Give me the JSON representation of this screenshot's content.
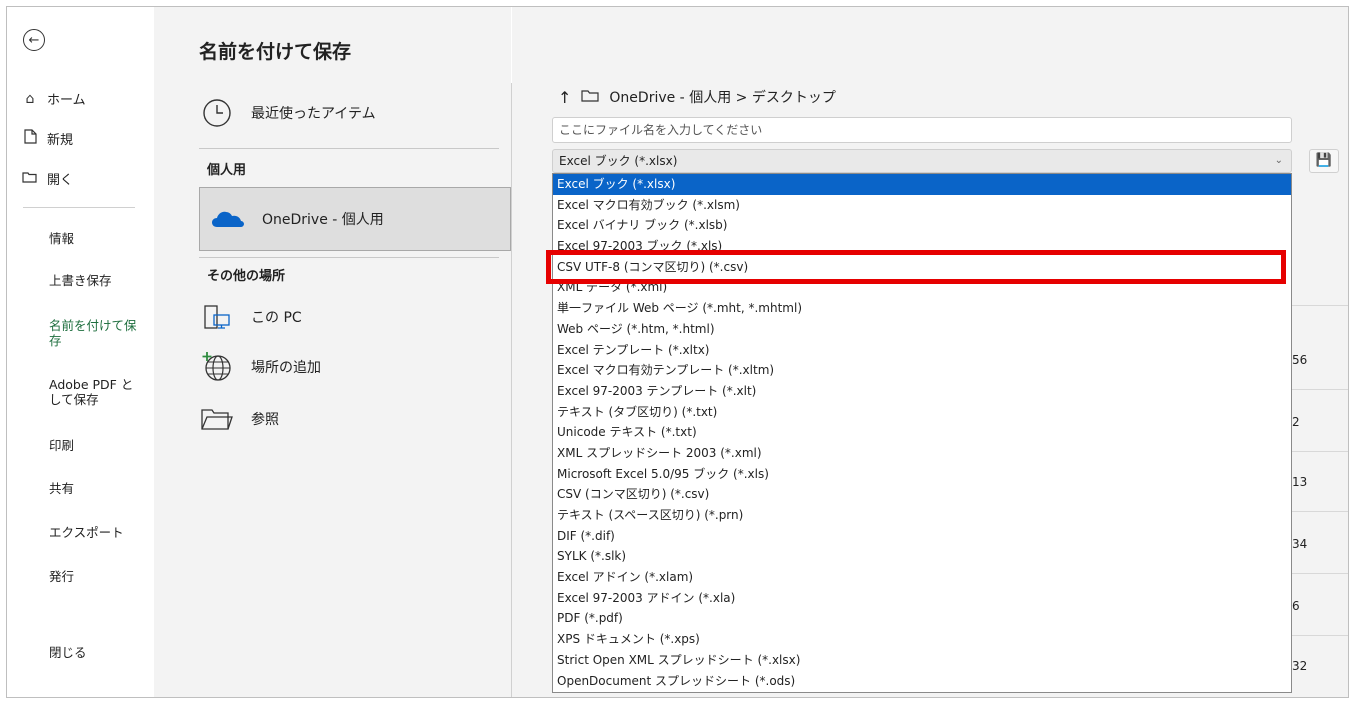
{
  "nav": {
    "back_icon": "back-arrow-icon",
    "home": "ホーム",
    "new": "新規",
    "open": "開く",
    "items": [
      "情報",
      "上書き保存",
      "名前を付けて保存",
      "Adobe PDF として保存",
      "印刷",
      "共有",
      "エクスポート",
      "発行",
      "閉じる"
    ]
  },
  "middle": {
    "title": "名前を付けて保存",
    "recent": "最近使ったアイテム",
    "personal_header": "個人用",
    "onedrive": "OneDrive - 個人用",
    "other_header": "その他の場所",
    "this_pc": "この PC",
    "add_place": "場所の追加",
    "browse": "参照"
  },
  "right": {
    "breadcrumb": "OneDrive - 個人用 > デスクトップ",
    "filename_placeholder": "ここにファイル名を入力してください",
    "filetype_selected": "Excel ブック (*.xlsx)",
    "options": [
      "Excel ブック (*.xlsx)",
      "Excel マクロ有効ブック (*.xlsm)",
      "Excel バイナリ ブック (*.xlsb)",
      "Excel 97-2003 ブック (*.xls)",
      "CSV UTF-8 (コンマ区切り) (*.csv)",
      "XML データ (*.xml)",
      "単一ファイル Web ページ (*.mht, *.mhtml)",
      "Web ページ (*.htm, *.html)",
      "Excel テンプレート (*.xltx)",
      "Excel マクロ有効テンプレート (*.xltm)",
      "Excel 97-2003 テンプレート (*.xlt)",
      "テキスト (タブ区切り) (*.txt)",
      "Unicode テキスト (*.txt)",
      "XML スプレッドシート 2003 (*.xml)",
      "Microsoft Excel 5.0/95 ブック (*.xls)",
      "CSV (コンマ区切り) (*.csv)",
      "テキスト (スペース区切り) (*.prn)",
      "DIF (*.dif)",
      "SYLK (*.slk)",
      "Excel アドイン (*.xlam)",
      "Excel 97-2003 アドイン (*.xla)",
      "PDF (*.pdf)",
      "XPS ドキュメント (*.xps)",
      "Strict Open XML スプレッドシート (*.xlsx)",
      "OpenDocument スプレッドシート (*.ods)"
    ],
    "side_numbers": [
      "56",
      "2",
      "13",
      "34",
      "6",
      "32"
    ]
  },
  "colors": {
    "selected": "#0a64c8",
    "highlight": "#e60000",
    "onedrive": "#0a64c8"
  }
}
